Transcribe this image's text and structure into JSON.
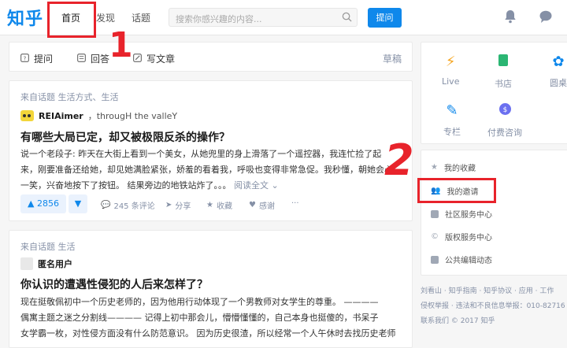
{
  "header": {
    "logo": "知乎",
    "nav": [
      "首页",
      "发现",
      "话题"
    ],
    "search_placeholder": "搜索你感兴趣的内容...",
    "ask_button": "提问"
  },
  "toolbar": {
    "ask": "提问",
    "answer": "回答",
    "write": "写文章",
    "drafts": "草稿"
  },
  "feed": [
    {
      "source": "来自话题 生活方式、生活",
      "author": "REIAimer",
      "author_bio": "，througH the valleY",
      "title": "有哪些大局已定，却又被极限反杀的操作？",
      "excerpt_lines": [
        "说一个老段子: 昨天在大街上看到一个美女，从她兜里的身上滑落了一个遥控器，我连忙捡了起",
        "来，刚要准备还给她，却见她满脸紧张，娇羞的看着我，呼吸也变得非常急促。我秒懂，朝她会心",
        "一笑，兴奋地按下了按钮。 结果旁边的地铁站炸了。。。"
      ],
      "read_more": "阅读全文",
      "votes": "2856",
      "comments": "245 条评论",
      "share": "分享",
      "collect": "收藏",
      "thanks": "感谢",
      "more": "···"
    },
    {
      "source": "来自话题 生活",
      "author": "匿名用户",
      "title": "你认识的遭遇性侵犯的人后来怎样了？",
      "excerpt_lines": [
        "现在挺敬佩初中一个历史老师的，因为他用行动体现了一个男教师对女学生的尊重。 ————",
        "偶寓主题之迷之分割线———— 记得上初中那会儿，懵懵懂懂的，自己本身也挺傻的，书呆子",
        "女学霸一枚，对性侵方面没有什么防范意识。 因为历史很渣，所以经常一个人午休时去找历史老师"
      ]
    }
  ],
  "sidebar": {
    "quick": [
      "Live",
      "书店",
      "圆桌",
      "专栏",
      "付费咨询"
    ],
    "links": [
      "我的收藏",
      "我的邀请",
      "社区服务中心",
      "版权服务中心",
      "公共编辑动态"
    ],
    "footer_lines": [
      "刘看山 · 知乎指南 · 知乎协议 · 应用 · 工作",
      "侵权举报 · 违法和不良信息举报：010-82716",
      "联系我们 © 2017 知乎"
    ]
  },
  "annotation": {
    "number_1": "1",
    "number_2": "2"
  },
  "colors": {
    "brand": "#0f88eb",
    "annotation": "#e8232b"
  }
}
